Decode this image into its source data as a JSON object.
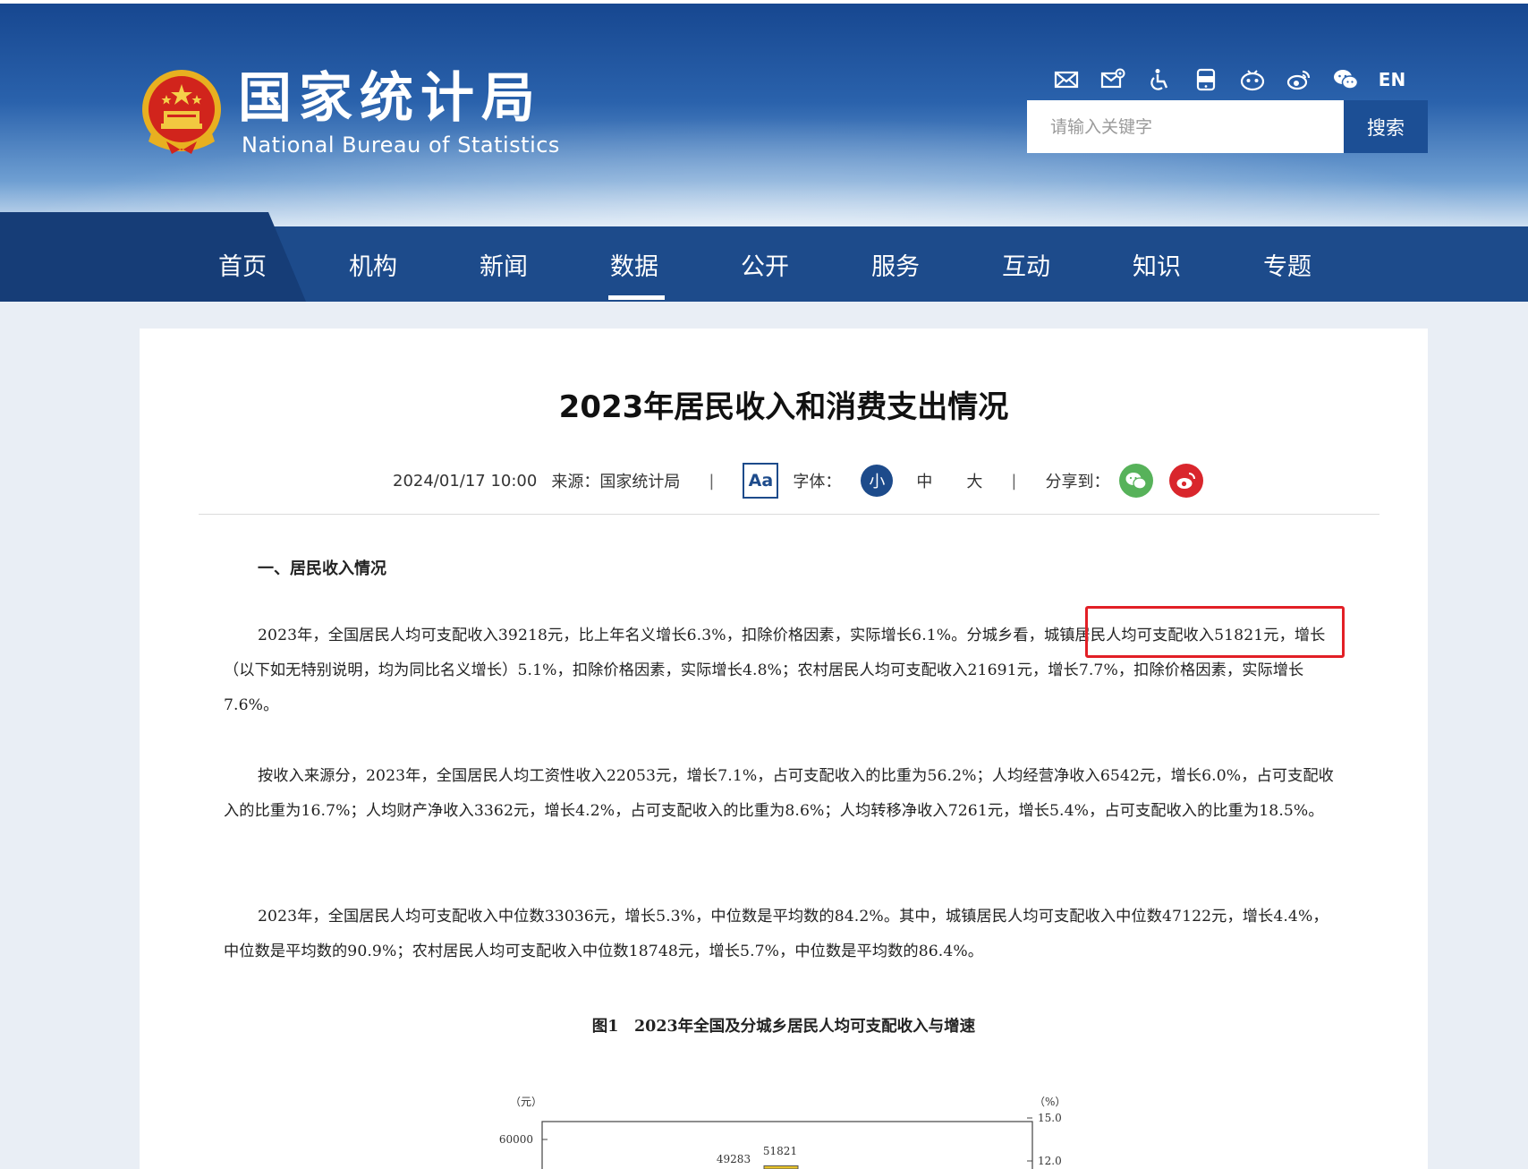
{
  "site": {
    "logo_cn": "国家统计局",
    "logo_en": "National Bureau of Statistics",
    "lang_toggle": "EN",
    "search_placeholder": "请输入关键字",
    "search_button": "搜索"
  },
  "nav": {
    "items": [
      {
        "label": "首页"
      },
      {
        "label": "机构"
      },
      {
        "label": "新闻"
      },
      {
        "label": "数据"
      },
      {
        "label": "公开"
      },
      {
        "label": "服务"
      },
      {
        "label": "互动"
      },
      {
        "label": "知识"
      },
      {
        "label": "专题"
      }
    ],
    "active_index": 3
  },
  "article": {
    "title": "2023年居民收入和消费支出情况",
    "date": "2024/01/17 10:00",
    "source": "来源：国家统计局",
    "font_toggle": "Aa",
    "font_label": "字体：",
    "font_small": "小",
    "font_medium": "中",
    "font_large": "大",
    "share_label": "分享到：",
    "section1": "一、居民收入情况",
    "para1": "2023年，全国居民人均可支配收入39218元，比上年名义增长6.3%，扣除价格因素，实际增长6.1%。分城乡看，城镇居民人均可支配收入51821元，增长（以下如无特别说明，均为同比名义增长）5.1%，扣除价格因素，实际增长4.8%；农村居民人均可支配收入21691元，增长7.7%，扣除价格因素，实际增长7.6%。",
    "para2": "按收入来源分，2023年，全国居民人均工资性收入22053元，增长7.1%，占可支配收入的比重为56.2%；人均经营净收入6542元，增长6.0%，占可支配收入的比重为16.7%；人均财产净收入3362元，增长4.2%，占可支配收入的比重为8.6%；人均转移净收入7261元，增长5.4%，占可支配收入的比重为18.5%。",
    "para3": "2023年，全国居民人均可支配收入中位数33036元，增长5.3%，中位数是平均数的84.2%。其中，城镇居民人均可支配收入中位数47122元，增长4.4%，中位数是平均数的90.9%；农村居民人均可支配收入中位数18748元，增长5.7%，中位数是平均数的86.4%。",
    "figure_title": "图1　2023年全国及分城乡居民人均可支配收入与增速"
  },
  "colors": {
    "nav_bg": "#1d4b8b",
    "highlight": "#e21f26",
    "bar_fill": "#e6c229"
  },
  "icons": [
    "mail-icon",
    "mail-settings-icon",
    "accessibility-icon",
    "app-icon",
    "robot-icon",
    "weibo-icon",
    "wechat-icon"
  ],
  "chart_data": {
    "type": "bar",
    "y_left_unit": "（元）",
    "y_right_unit": "（%）",
    "y_left_ticks": [
      60000
    ],
    "y_right_ticks": [
      15.0,
      12.0
    ],
    "visible_values": [
      49283,
      51821
    ]
  }
}
